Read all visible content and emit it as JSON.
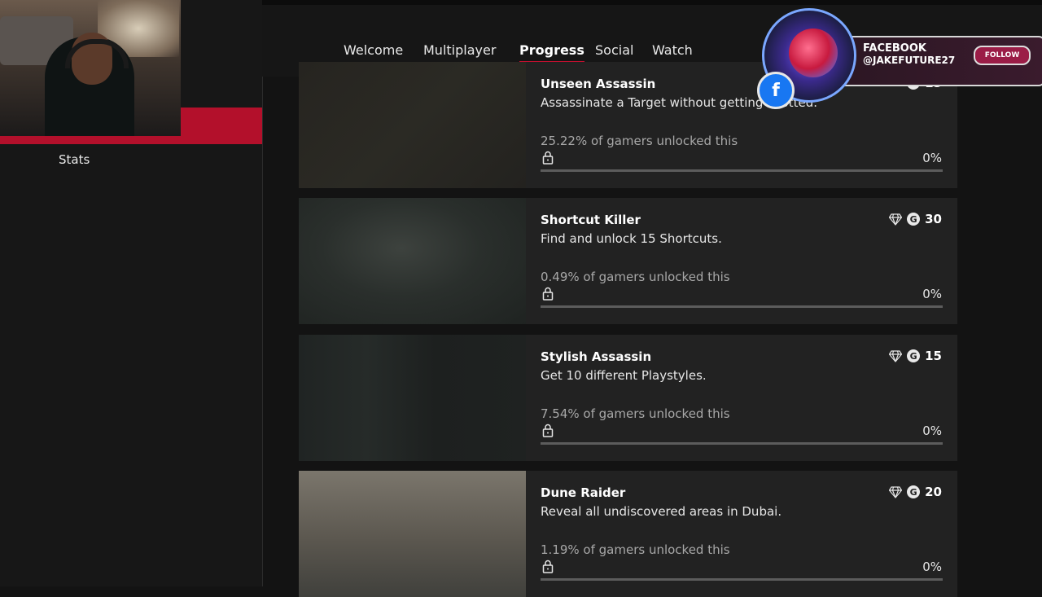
{
  "nav": {
    "items": [
      "Welcome",
      "Multiplayer",
      "Progress",
      "Social",
      "Watch"
    ],
    "active": "Progress"
  },
  "sidebar": {
    "stats_label": "Stats"
  },
  "overlay": {
    "facebook_label": "FACEBOOK",
    "handle": "@JAKEFUTURE27",
    "follow_label": "FOLLOW",
    "fb_icon": "f"
  },
  "achievements": [
    {
      "title": "Unseen Assassin",
      "description": "Assassinate a Target without getting spotted.",
      "unlock_text": "25.22% of gamers unlocked this",
      "gamerscore": "15",
      "progress_label": "0%",
      "progress": 0,
      "rare": false
    },
    {
      "title": "Shortcut Killer",
      "description": "Find and unlock 15 Shortcuts.",
      "unlock_text": "0.49% of gamers unlocked this",
      "gamerscore": "30",
      "progress_label": "0%",
      "progress": 0,
      "rare": true
    },
    {
      "title": "Stylish Assassin",
      "description": "Get 10 different Playstyles.",
      "unlock_text": "7.54% of gamers unlocked this",
      "gamerscore": "15",
      "progress_label": "0%",
      "progress": 0,
      "rare": true
    },
    {
      "title": "Dune Raider",
      "description": "Reveal all undiscovered areas in Dubai.",
      "unlock_text": "1.19% of gamers unlocked this",
      "gamerscore": "20",
      "progress_label": "0%",
      "progress": 0,
      "rare": true
    }
  ],
  "colors": {
    "accent_red": "#c2102f",
    "card_bg": "#222222",
    "page_bg": "#131313"
  },
  "icons": {
    "gamerscore": "g-icon",
    "rare": "diamond-icon",
    "lock": "lock-icon"
  }
}
